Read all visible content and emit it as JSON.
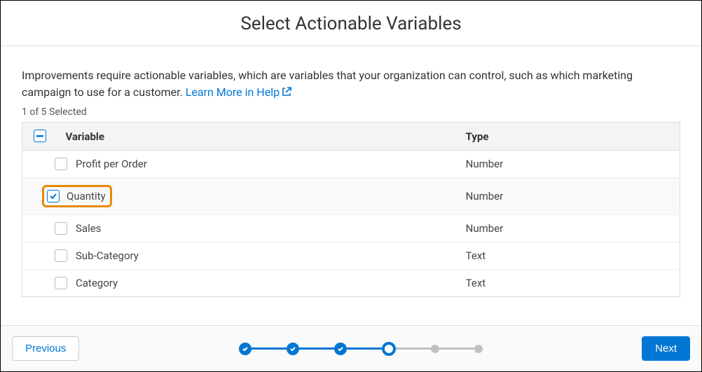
{
  "header": {
    "title": "Select Actionable Variables"
  },
  "description": {
    "text": "Improvements require actionable variables, which are variables that your organization can control, such as which marketing campaign to use for a customer. ",
    "link_label": "Learn More in Help"
  },
  "selection_count": "1 of 5 Selected",
  "table": {
    "col_variable": "Variable",
    "col_type": "Type",
    "rows": [
      {
        "variable": "Profit per Order",
        "type": "Number",
        "checked": false,
        "highlight": false
      },
      {
        "variable": "Quantity",
        "type": "Number",
        "checked": true,
        "highlight": true
      },
      {
        "variable": "Sales",
        "type": "Number",
        "checked": false,
        "highlight": false
      },
      {
        "variable": "Sub-Category",
        "type": "Text",
        "checked": false,
        "highlight": false
      },
      {
        "variable": "Category",
        "type": "Text",
        "checked": false,
        "highlight": false
      }
    ]
  },
  "footer": {
    "prev_label": "Previous",
    "next_label": "Next"
  }
}
